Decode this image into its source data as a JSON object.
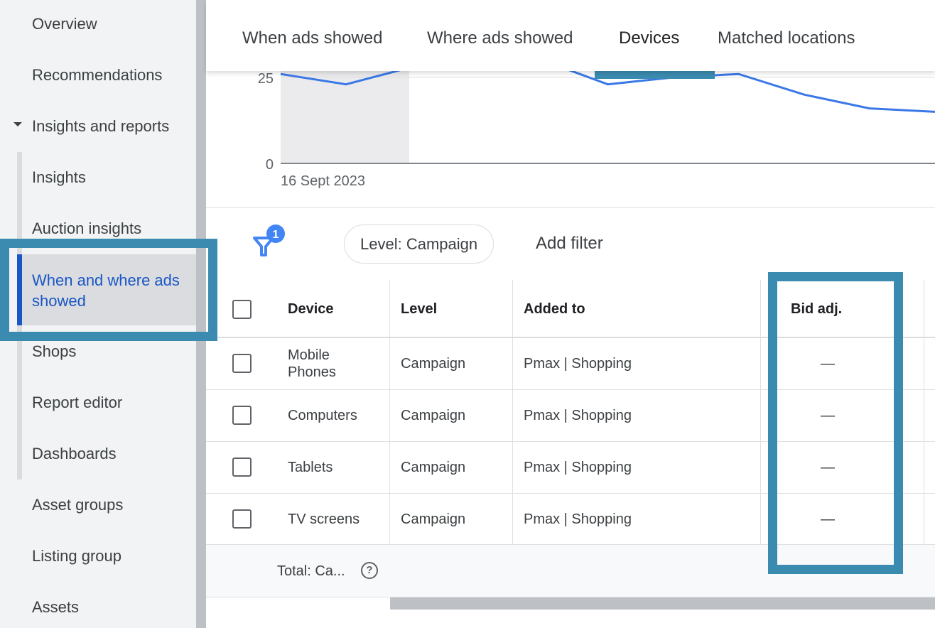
{
  "sidebar": {
    "items": [
      {
        "label": "Overview"
      },
      {
        "label": "Recommendations"
      },
      {
        "label": "Insights and reports"
      },
      {
        "label": "Insights"
      },
      {
        "label": "Auction insights"
      },
      {
        "label": "When and where ads showed"
      },
      {
        "label": "Shops"
      },
      {
        "label": "Report editor"
      },
      {
        "label": "Dashboards"
      },
      {
        "label": "Asset groups"
      },
      {
        "label": "Listing group"
      },
      {
        "label": "Assets"
      }
    ],
    "expanded_item": "Insights and reports",
    "selected_item": "When and where ads showed"
  },
  "tabs": {
    "items": [
      {
        "label": "When ads showed"
      },
      {
        "label": "Where ads showed"
      },
      {
        "label": "Devices"
      },
      {
        "label": "Matched locations"
      }
    ],
    "selected": "Devices"
  },
  "chart": {
    "y_tick_25": "25",
    "y_tick_0": "0",
    "x_start_label": "16 Sept 2023"
  },
  "chart_data": {
    "type": "line",
    "x_start": "16 Sept 2023",
    "ylim": [
      0,
      25
    ],
    "grid": true,
    "series": [
      {
        "values": [
          26,
          23,
          28,
          30,
          30,
          23,
          25,
          26,
          20,
          16,
          15
        ]
      }
    ],
    "highlighted_range": "first period",
    "colors": {
      "line": "#3b78e7"
    }
  },
  "filters": {
    "badge_count": "1",
    "level_chip": "Level: Campaign",
    "add_filter": "Add filter"
  },
  "table": {
    "columns": [
      "Device",
      "Level",
      "Added to",
      "Bid adj."
    ],
    "rows": [
      {
        "device": "Mobile Phones",
        "level": "Campaign",
        "added_to": "Pmax | Shopping",
        "bid_adj": "—"
      },
      {
        "device": "Computers",
        "level": "Campaign",
        "added_to": "Pmax | Shopping",
        "bid_adj": "—"
      },
      {
        "device": "Tablets",
        "level": "Campaign",
        "added_to": "Pmax | Shopping",
        "bid_adj": "—"
      },
      {
        "device": "TV screens",
        "level": "Campaign",
        "added_to": "Pmax | Shopping",
        "bid_adj": "—"
      }
    ],
    "total_label": "Total: Ca..."
  },
  "icons": {
    "expand": "caret-down-icon",
    "filter": "filter-icon",
    "help": "help-circle-icon"
  },
  "colors": {
    "accent": "#1a56c4",
    "highlight_box": "#3b8bb0",
    "badge": "#4285f4"
  }
}
